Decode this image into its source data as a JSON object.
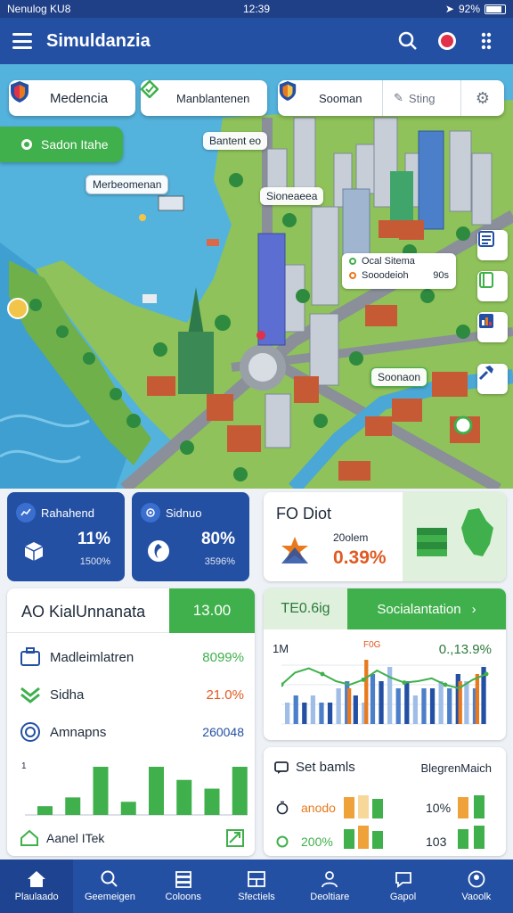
{
  "status_bar": {
    "left": "Nenulog  KU8",
    "time": "12:39",
    "battery": "92%"
  },
  "app_bar": {
    "title": "Simuldanzia"
  },
  "map": {
    "chips": [
      "Medencia",
      "Manblantenen",
      "Sooman",
      "Sting"
    ],
    "location_pill": "Sadon Itahe",
    "labels": [
      "Bantent eo",
      "Merbeomenan",
      "Sioneaeea",
      "Soonaon"
    ],
    "info_card": [
      "Ocal Sitema",
      "Sooodeioh",
      "90s"
    ]
  },
  "stats": [
    {
      "label": "Rahahend",
      "value": "11%",
      "sub": "1500%"
    },
    {
      "label": "Sidnuo",
      "value": "80%",
      "sub": "3596%"
    }
  ],
  "fo_card": {
    "title": "FO Diot",
    "label": "20olem",
    "value": "0.39%"
  },
  "analysis": {
    "title": "AO KialUnnanata",
    "value": "13.00",
    "rows": [
      {
        "label": "Madleimlatren",
        "value": "8099%"
      },
      {
        "label": "Sidha",
        "value": "21.0%"
      },
      {
        "label": "Amnapns",
        "value": "260048"
      }
    ],
    "chart_y_tick": "1",
    "bar_values": [
      2,
      4,
      11,
      3,
      11,
      8,
      6,
      11
    ],
    "footer": "Aanel ITek"
  },
  "trend": {
    "tab1": "TE0.6ig",
    "tab2": "Socialantation",
    "ylabel": "1M",
    "value": "0.,13.9%",
    "marker": "F0G"
  },
  "chart_data": {
    "type": "bar",
    "title": "",
    "y_tick": "1M",
    "series": [
      {
        "values": [
          3,
          4,
          3,
          4,
          3,
          3,
          5,
          6,
          4,
          3,
          7,
          6,
          8,
          5,
          6,
          4,
          5,
          5,
          6,
          5,
          7,
          6,
          5,
          8
        ]
      }
    ],
    "highlight_values": [
      5,
      9,
      6,
      7
    ],
    "line": [
      0.55,
      0.72,
      0.78,
      0.7,
      0.6,
      0.55,
      0.62,
      0.75,
      0.65,
      0.58,
      0.6,
      0.64,
      0.55,
      0.5,
      0.62,
      0.7
    ]
  },
  "set_card": {
    "title": "Set bamls",
    "right_title": "BlegrenMaich",
    "rows": [
      {
        "left": "anodo",
        "right": "10%"
      },
      {
        "left": "200%",
        "right": "103"
      }
    ]
  },
  "nav": [
    "Plaulaado",
    "Geemeigen",
    "Coloons",
    "Sfectiels",
    "Deoltiare",
    "Gapol",
    "Vaoolk"
  ],
  "colors": {
    "primary": "#2450a4",
    "accent": "#3fb04b",
    "orange": "#e9791d"
  }
}
